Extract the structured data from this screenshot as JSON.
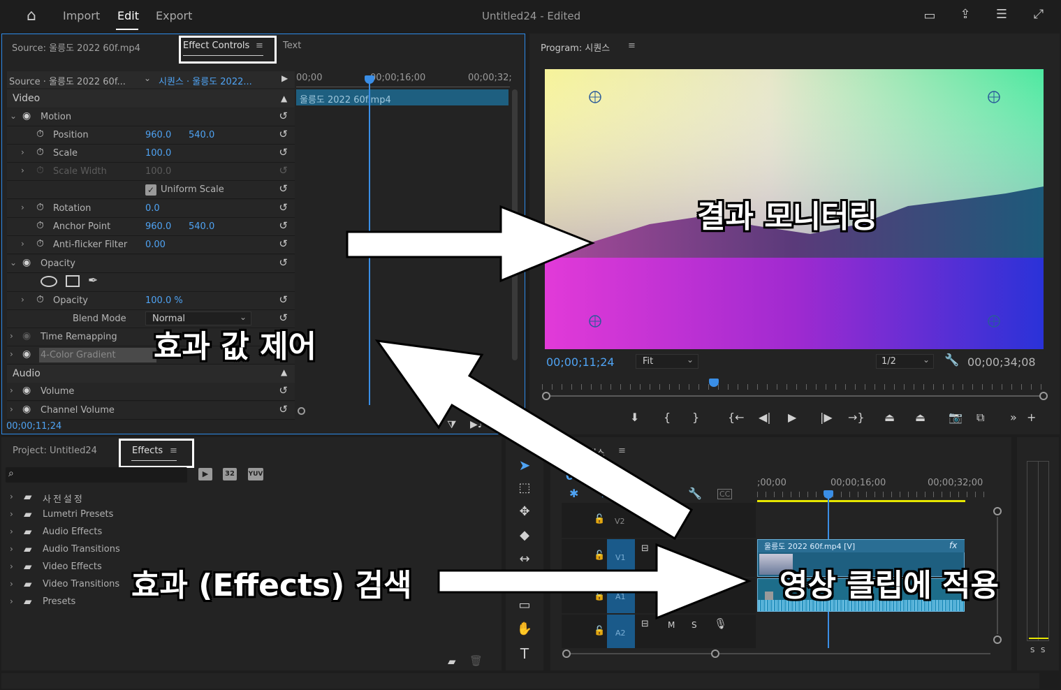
{
  "topbar": {
    "home_icon": "home-icon",
    "menu": [
      "Import",
      "Edit",
      "Export"
    ],
    "title": "Untitled24",
    "edited": " - Edited",
    "icons": [
      "panel-icon",
      "share-icon",
      "list-icon",
      "fullscreen-icon"
    ]
  },
  "source_panel": {
    "tab_source": "Source: 울릉도 2022 60f.mp4",
    "tab_effect_controls": "Effect Controls",
    "tab_text": "Text",
    "source_label": "Source · 울릉도 2022 60f...",
    "sequence_label": "시퀀스 · 울릉도 2022...",
    "ruler": [
      "00;00",
      "00;00;16;00",
      "00;00;32;"
    ],
    "clip_name": "울릉도 2022 60f.mp4",
    "timecode": "00;00;11;24",
    "sections": {
      "video": "Video",
      "audio": "Audio"
    },
    "rows": {
      "motion": "Motion",
      "position": {
        "label": "Position",
        "x": "960.0",
        "y": "540.0"
      },
      "scale": {
        "label": "Scale",
        "value": "100.0"
      },
      "scale_width": {
        "label": "Scale Width",
        "value": "100.0"
      },
      "uniform_scale": "Uniform Scale",
      "rotation": {
        "label": "Rotation",
        "value": "0.0"
      },
      "anchor_point": {
        "label": "Anchor Point",
        "x": "960.0",
        "y": "540.0"
      },
      "anti_flicker": {
        "label": "Anti-flicker Filter",
        "value": "0.00"
      },
      "opacity_group": "Opacity",
      "opacity": {
        "label": "Opacity",
        "value": "100.0 %"
      },
      "blend_mode": {
        "label": "Blend Mode",
        "value": "Normal"
      },
      "time_remapping": "Time Remapping",
      "color_gradient": "4-Color Gradient",
      "volume": "Volume",
      "channel_volume": "Channel Volume"
    }
  },
  "program_panel": {
    "title": "Program: 시퀀스",
    "timecode": "00;00;11;24",
    "fit": "Fit",
    "resolution": "1/2",
    "duration": "00;00;34;08"
  },
  "project_panel": {
    "tab_project": "Project: Untitled24",
    "tab_effects": "Effects",
    "badges": [
      "32",
      "YUV"
    ],
    "items": [
      "사전설정",
      "Lumetri Presets",
      "Audio Effects",
      "Audio Transitions",
      "Video Effects",
      "Video Transitions",
      "Presets"
    ]
  },
  "timeline": {
    "title": "시퀀스",
    "timecode": "00;0",
    "ruler": [
      ";00;00",
      "00;00;16;00",
      "00;00;32;00"
    ],
    "tracks": [
      "V2",
      "V1",
      "A1",
      "A2"
    ],
    "clip_label": "울릉도 2022 60f.mp4 [V]",
    "fx": "fx",
    "mute": "M",
    "solo": "S",
    "meter": [
      "S",
      "S"
    ]
  },
  "annotations": {
    "result": "결과 모니터링",
    "effect_values": "효과 값 제어",
    "search": "효과 (Effects) 검색",
    "apply": "영상 클립에 적용"
  },
  "colors": {
    "accent": "#2d8ceb",
    "value_blue": "#4fa3f3",
    "playhead": "#3a8ee6",
    "work_area": "#e6e600"
  }
}
